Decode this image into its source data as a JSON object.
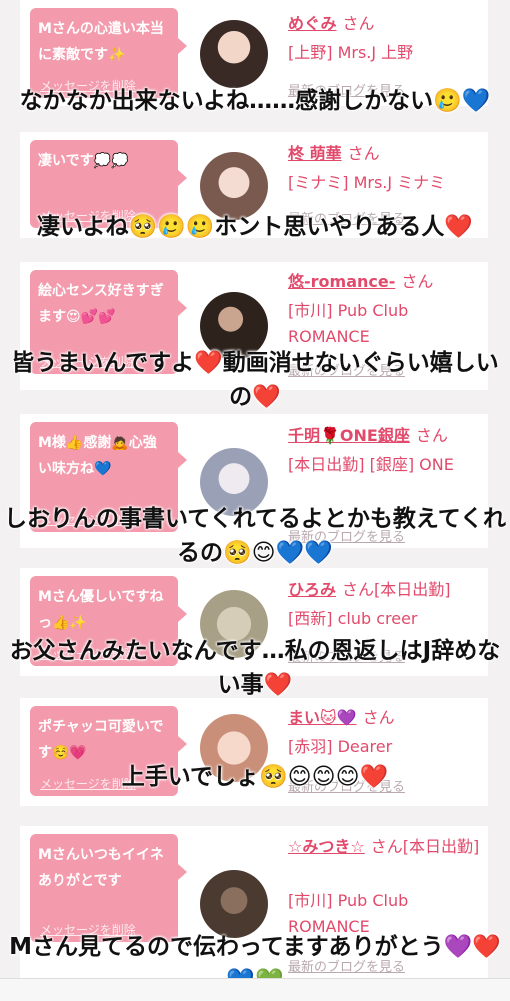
{
  "cards": [
    {
      "bubble": "Mさんの心遣い本当に素敵です✨",
      "delete": "メッセージを削除",
      "name": "めぐみ",
      "san": "さん",
      "shop": "[上野] Mrs.J 上野",
      "blog": "最新のブログを見る",
      "avatar_color": "#3a2a26"
    },
    {
      "bubble": "凄いです💭💭",
      "delete": "メッセージを削除",
      "name": "柊 萌華",
      "san": "さん",
      "shop": "[ミナミ] Mrs.J ミナミ",
      "blog": "最新のブログを見る",
      "avatar_color": "#d9b4a6"
    },
    {
      "bubble": "絵心センス好きすぎます😍💕💕",
      "delete": "メッセージを削除",
      "name": "悠-romance-",
      "san": "さん",
      "shop": "[市川] Pub Club ROMANCE",
      "blog": "最新のブログを見る",
      "avatar_color": "#2e221c"
    },
    {
      "bubble": "M様👍感謝🙇心強い味方ね💙",
      "delete": "メッセージを削除",
      "name": "千明🌹ONE銀座",
      "san": "さん",
      "shop": "[本日出勤] [銀座] ONE",
      "blog": "最新のブログを見る",
      "avatar_color": "#9aa0b5"
    },
    {
      "bubble": "Mさん優しいですねっ👍✨",
      "delete": "メッセージを削除",
      "name": "ひろみ",
      "san": "さん[本日出勤]",
      "shop": "[西新] club creer",
      "blog": "最新のブログを見る",
      "avatar_color": "#a79f86"
    },
    {
      "bubble": "ポチャッコ可愛いです☺️💗",
      "delete": "メッセージを削除",
      "name": "まい🐱💜",
      "san": "さん",
      "shop": "[赤羽] Dearer",
      "blog": "最新のブログを見る",
      "avatar_color": "#e8b7a4"
    },
    {
      "bubble": "Mさんいつもイイネありがとです",
      "delete": "メッセージを削除",
      "name": "☆みつき☆",
      "san": "さん[本日出勤]",
      "shop": "[市川] Pub Club ROMANCE",
      "blog": "最新のブログを見る",
      "avatar_color": "#4a3a30"
    }
  ],
  "captions": [
    {
      "text": "なかなか出来ないよね……感謝しかない🥲💙"
    },
    {
      "text": "凄いよね🥺🥲🥲ホント思いやりある人❤️"
    },
    {
      "text": "皆うまいんですよ❤️動画消せないぐらい嬉しいの❤️"
    },
    {
      "text": "しおりんの事書いてくれてるよとかも教えてくれるの🥺😊💙💙"
    },
    {
      "text": "お父さんみたいなんです…私の恩返しはJ辞めない事❤️"
    },
    {
      "text": "上手いでしょ🥺😊😊😊❤️"
    },
    {
      "text": "Mさん見てるので伝わってますありがとう💜❤️💙💚"
    }
  ]
}
